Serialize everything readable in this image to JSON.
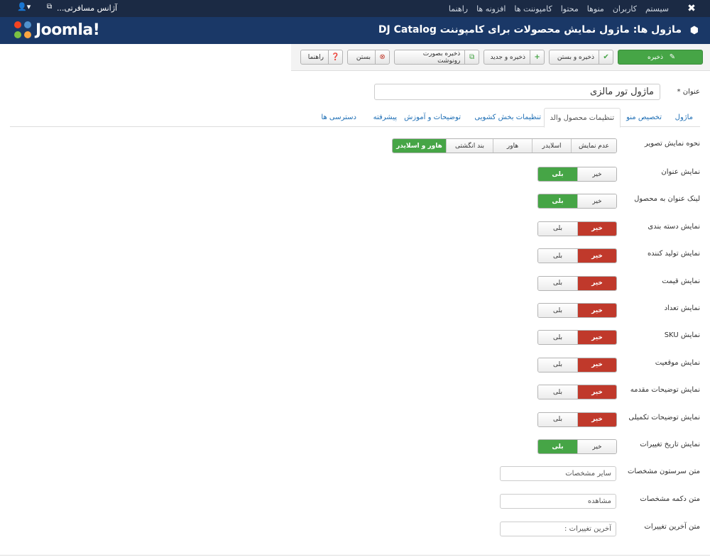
{
  "topbar": {
    "nav": [
      "سیستم",
      "کاربران",
      "منوها",
      "محتوا",
      "کامپوننت ها",
      "افزونه ها",
      "راهنما"
    ],
    "site_name": "آژانس مسافرتی...",
    "user_icon": "user-icon",
    "joomla_icon": "joomla-icon"
  },
  "header": {
    "logo_text": "Joomla!",
    "title": "ماژول ها: ماژول نمایش محصولات برای کامپوننت DJ Catalog",
    "cube_icon": "cube-icon"
  },
  "toolbar": {
    "save": "ذخیره",
    "save_close": "ذخیره و بستن",
    "save_new": "ذخیره و جدید",
    "save_copy": "ذخیره بصورت رونوشت",
    "close": "بستن",
    "help": "راهنما"
  },
  "form": {
    "title_label": "عنوان *",
    "title_value": "ماژول تور مالزی"
  },
  "tabs": [
    "ماژول",
    "تخصیص منو",
    "تنظیمات محصول والد",
    "تنظیمات بخش کشویی",
    "توضیحات و آموزش",
    "پیشرفته",
    "دسترسی ها"
  ],
  "image_mode": {
    "label": "نحوه نمایش تصویر",
    "options": [
      "عدم نمایش",
      "اسلایدر",
      "هاور",
      "بند انگشتی",
      "هاور و اسلایدر"
    ],
    "selected": "هاور و اسلایدر"
  },
  "toggles": [
    {
      "label": "نمایش عنوان",
      "no": "خیر",
      "yes": "بلی",
      "value": "yes"
    },
    {
      "label": "لینک عنوان به محصول",
      "no": "خیر",
      "yes": "بلی",
      "value": "yes"
    },
    {
      "label": "نمایش دسته بندی",
      "no": "خیر",
      "yes": "بلی",
      "value": "no"
    },
    {
      "label": "نمایش تولید کننده",
      "no": "خیر",
      "yes": "بلی",
      "value": "no"
    },
    {
      "label": "نمایش قیمت",
      "no": "خیر",
      "yes": "بلی",
      "value": "no"
    },
    {
      "label": "نمایش تعداد",
      "no": "خیر",
      "yes": "بلی",
      "value": "no"
    },
    {
      "label": "نمایش SKU",
      "no": "خیر",
      "yes": "بلی",
      "value": "no"
    },
    {
      "label": "نمایش موقعیت",
      "no": "خیر",
      "yes": "بلی",
      "value": "no"
    },
    {
      "label": "نمایش توضیحات مقدمه",
      "no": "خیر",
      "yes": "بلی",
      "value": "no"
    },
    {
      "label": "نمایش توضیحات تکمیلی",
      "no": "خیر",
      "yes": "بلی",
      "value": "no"
    },
    {
      "label": "نمایش تاریخ تغییرات",
      "no": "خیر",
      "yes": "بلی",
      "value": "yes"
    }
  ],
  "text_fields": [
    {
      "label": "متن سرستون مشخصات",
      "value": "سایر مشخصات"
    },
    {
      "label": "متن دکمه مشخصات",
      "value": "مشاهده"
    },
    {
      "label": "متن آخرین تغییرات",
      "value": "آخرین تغییرات :"
    }
  ],
  "colors": {
    "topbar": "#1b2a44",
    "header": "#1a3867",
    "green": "#46a546",
    "red": "#c0392b",
    "link": "#1f6fb5"
  }
}
